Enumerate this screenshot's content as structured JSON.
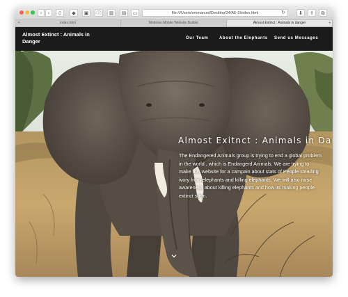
{
  "browser": {
    "tabs": [
      {
        "label": "index.html",
        "active": false
      },
      {
        "label": "Mobirise Mobile Website Builder",
        "active": false
      },
      {
        "label": "Almost Extinct : Animals in danger",
        "active": true
      }
    ],
    "address": "file:///Users/emmanuel/Desktop/34/AE-2/index.html",
    "icons": [
      "back-icon",
      "forward-icon",
      "sidebar-icon",
      "extensions-icon",
      "reload-icon",
      "download-icon",
      "share-icon",
      "tabs-icon",
      "new-tab-icon"
    ]
  },
  "site": {
    "brand": "Almost Extinct : Animals in Danger",
    "nav": [
      "Our Team",
      "About the Elephants",
      "Send us Messages"
    ]
  },
  "hero": {
    "title": "Almost Exitnct : Animals in Danger",
    "text": "The Endangered Animals group is trying to end a global problem in the world , which is Endangerd Animals. We are trying to make this website for a campain about stats of People stealling ivory from elephants and killing elephants. We will also raise awareness about killing elephants and how its making people extinct soon.",
    "scroll_icon": "chevron-down-icon"
  },
  "colors": {
    "navbar": "#1b1b1b",
    "nav_text": "#ffffff",
    "savanna": "#c4a26a",
    "elephant": "#5d554b"
  }
}
